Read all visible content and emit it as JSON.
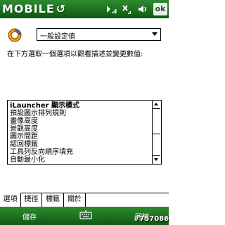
{
  "titlebar": {
    "app_name": "MOBILE",
    "ok_label": "ok"
  },
  "icons": {
    "signal": "signal-icon",
    "network": "network-off-icon",
    "volume": "volume-icon",
    "settings": "settings-icon",
    "keyboard": "keyboard-icon"
  },
  "settings_select": {
    "value": "一般設定值"
  },
  "instruction": "在下方選取一個選項以觀看描述並變更數值:",
  "options_list": [
    "iLauncher 顯示模式",
    "預設圖示排列規則",
    "畫像高度",
    "景觀高度",
    "圖示間距",
    "認回標籤",
    "工具列反向順序填充",
    "自動最小化"
  ],
  "tabs": [
    "選項",
    "捷徑",
    "標籤",
    "關於"
  ],
  "menubar": {
    "left": "儲存",
    "right": "回饋"
  },
  "watermark": "#757086",
  "colors": {
    "bar_green": "#1f7a24",
    "bar_text": "#ffffff"
  }
}
